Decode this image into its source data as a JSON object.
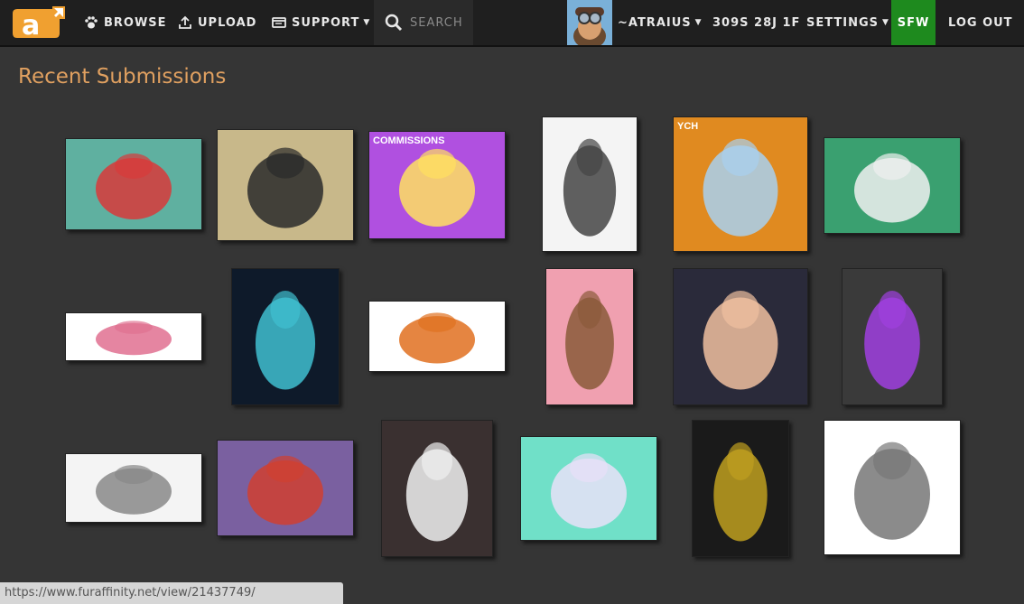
{
  "nav": {
    "browse_label": "BROWSE",
    "upload_label": "UPLOAD",
    "support_label": "SUPPORT",
    "search_placeholder": "SEARCH",
    "username_label": "~ATRAIUS",
    "notifications_label": "309S 28J 1F",
    "settings_label": "SETTINGS",
    "sfw_label": "SFW",
    "logout_label": "LOG OUT"
  },
  "page": {
    "title": "Recent Submissions"
  },
  "thumbnails": [
    {
      "desc": "mech-character",
      "bg": "#5fb0a0",
      "accent": "#d83a3a"
    },
    {
      "desc": "two-characters-building",
      "bg": "#c8b88a",
      "accent": "#2a2a2a"
    },
    {
      "desc": "commissions-open",
      "bg": "#b050e0",
      "accent": "#ffe060",
      "text": "COMMISSIONS"
    },
    {
      "desc": "comic-page",
      "bg": "#f4f4f4",
      "accent": "#444"
    },
    {
      "desc": "ych-wolf",
      "bg": "#e08a20",
      "accent": "#a8d0f0",
      "text": "YCH"
    },
    {
      "desc": "reference-sheet",
      "bg": "#3aa070",
      "accent": "#f0f0f0"
    },
    {
      "desc": "pixel-sprites",
      "bg": "#ffffff",
      "accent": "#e07090"
    },
    {
      "desc": "dark-dragon",
      "bg": "#0e1a2a",
      "accent": "#40c0d0"
    },
    {
      "desc": "pumpkin-cat",
      "bg": "#ffffff",
      "accent": "#e07020"
    },
    {
      "desc": "bear-pink",
      "bg": "#f0a0b0",
      "accent": "#8a5a3a"
    },
    {
      "desc": "tiger-portrait",
      "bg": "#2a2a3a",
      "accent": "#f0c0a0"
    },
    {
      "desc": "halloween-purple",
      "bg": "#3a3a3a",
      "accent": "#a040e0"
    },
    {
      "desc": "sketch-faces",
      "bg": "#f4f4f4",
      "accent": "#888"
    },
    {
      "desc": "colored-pencil",
      "bg": "#7a60a0",
      "accent": "#d04030"
    },
    {
      "desc": "fursuit-photo",
      "bg": "#3a3030",
      "accent": "#f0f0f0"
    },
    {
      "desc": "lavender-creature",
      "bg": "#70e0c8",
      "accent": "#e8e0f8"
    },
    {
      "desc": "dark-panther",
      "bg": "#1a1a1a",
      "accent": "#c0a020"
    },
    {
      "desc": "robot-sketch",
      "bg": "#ffffff",
      "accent": "#777"
    }
  ],
  "status": {
    "url": "https://www.furaffinity.net/view/21437749/"
  },
  "colors": {
    "topbar": "#1f1f1f",
    "background": "#353535",
    "title": "#e0a060",
    "sfw_badge": "#1e8a1e",
    "logo": "#f0a030"
  },
  "icons": [
    "paw-icon",
    "upload-icon",
    "support-icon",
    "search-icon",
    "caret-down-icon"
  ]
}
